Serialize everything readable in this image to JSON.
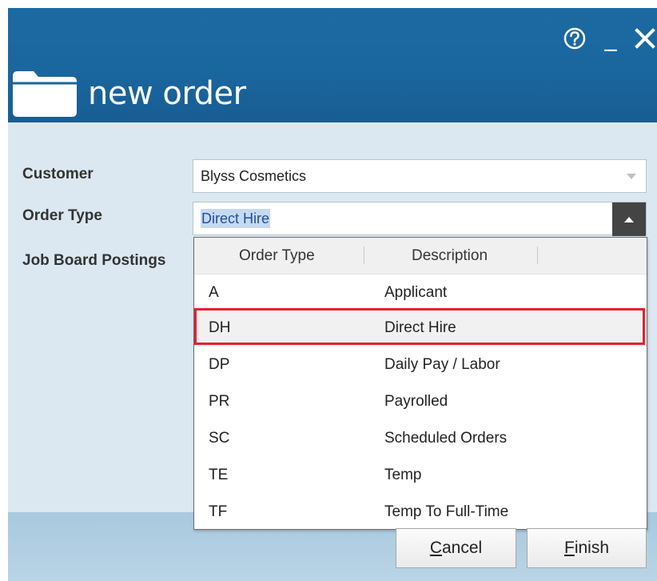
{
  "window": {
    "title": "new order",
    "help_glyph": "⑦",
    "minimize_glyph": "_",
    "close_glyph": "✕"
  },
  "form": {
    "customer_label": "Customer",
    "customer_value": "Blyss Cosmetics",
    "order_type_label": "Order Type",
    "order_type_value": "Direct Hire",
    "job_board_label": "Job Board Postings"
  },
  "dropdown": {
    "columns": [
      "Order Type",
      "Description"
    ],
    "rows": [
      {
        "code": "A",
        "description": "Applicant"
      },
      {
        "code": "DH",
        "description": "Direct Hire"
      },
      {
        "code": "DP",
        "description": "Daily Pay / Labor"
      },
      {
        "code": "PR",
        "description": "Payrolled"
      },
      {
        "code": "SC",
        "description": "Scheduled Orders"
      },
      {
        "code": "TE",
        "description": "Temp"
      },
      {
        "code": "TF",
        "description": "Temp To Full-Time"
      }
    ],
    "selected_index": 1
  },
  "buttons": {
    "cancel_mnemonic": "C",
    "cancel_rest": "ancel",
    "finish_mnemonic": "F",
    "finish_rest": "inish"
  },
  "colors": {
    "titlebar": "#1a659d",
    "body": "#dbe8f1",
    "highlight": "#e22230"
  }
}
